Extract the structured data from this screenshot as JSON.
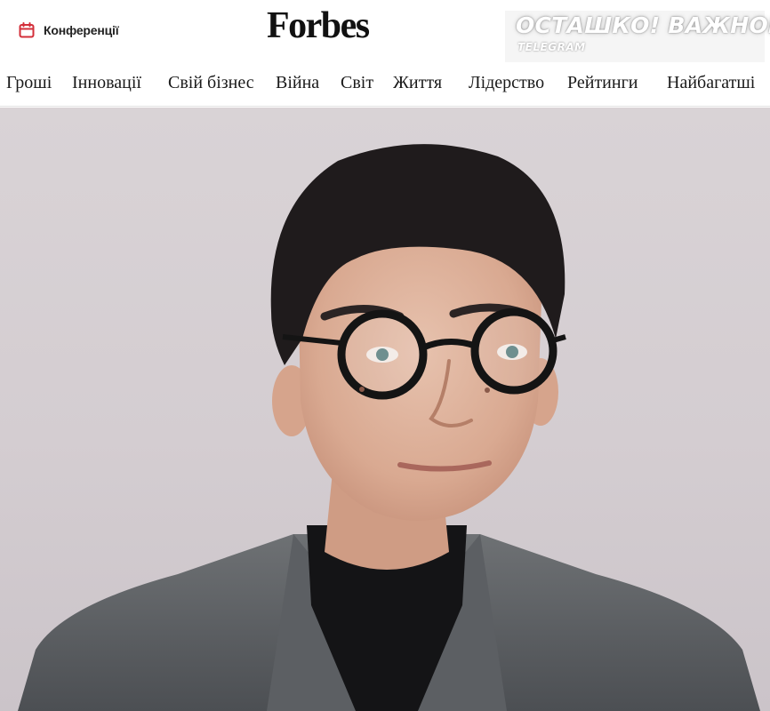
{
  "header": {
    "conferences_label": "Конференції",
    "conferences_icon": "calendar-icon",
    "logo": "Forbes",
    "watermark": {
      "title": "ОСТАШКО! ВАЖНОЕ",
      "subtitle": "TELEGRAM"
    }
  },
  "nav": {
    "items": [
      {
        "label": "Гроші"
      },
      {
        "label": "Інновації"
      },
      {
        "label": "Свій бізнес"
      },
      {
        "label": "Війна"
      },
      {
        "label": "Світ"
      },
      {
        "label": "Життя"
      },
      {
        "label": "Лідерство"
      },
      {
        "label": "Рейтинги"
      },
      {
        "label": "Найбагатші"
      }
    ]
  },
  "colors": {
    "accent": "#d32f3a",
    "text": "#1a1a1a",
    "hero_background": "#d6d0d3"
  }
}
